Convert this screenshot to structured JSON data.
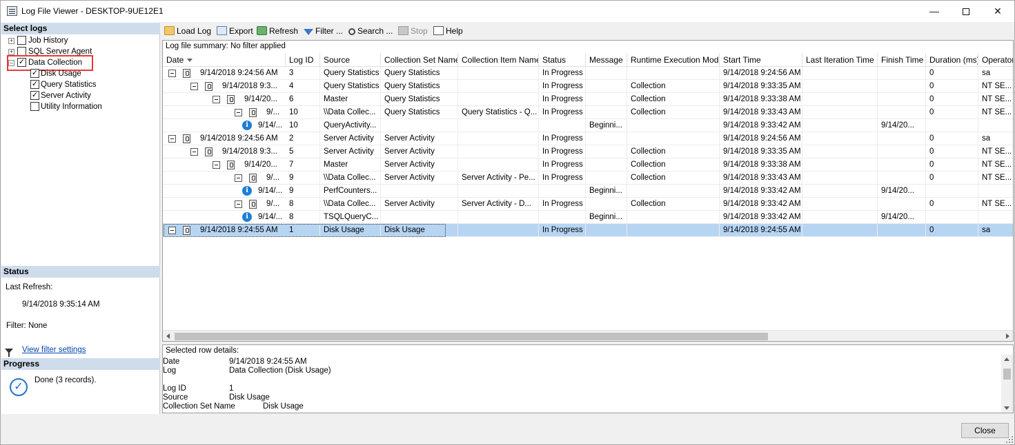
{
  "window": {
    "title": "Log File Viewer - DESKTOP-9UE12E1"
  },
  "left": {
    "select_logs_header": "Select logs",
    "tree": {
      "job_history": "Job History",
      "sql_server_agent": "SQL Server Agent",
      "data_collection": "Data Collection",
      "children": [
        "Disk Usage",
        "Query Statistics",
        "Server Activity",
        "Utility Information"
      ]
    },
    "status": {
      "header": "Status",
      "last_refresh_label": "Last Refresh:",
      "last_refresh_value": "9/14/2018 9:35:14 AM",
      "filter": "Filter: None",
      "view_filter_link": "View filter settings"
    },
    "progress": {
      "header": "Progress",
      "text": "Done (3 records)."
    }
  },
  "toolbar": {
    "load_log": "Load Log",
    "export": "Export",
    "refresh": "Refresh",
    "filter": "Filter ...",
    "search": "Search ...",
    "stop": "Stop",
    "help": "Help"
  },
  "grid": {
    "summary": "Log file summary: No filter applied",
    "columns": [
      "Date",
      "Log ID",
      "Source",
      "Collection Set Name",
      "Collection Item Name",
      "Status",
      "Message",
      "Runtime Execution Mode",
      "Start Time",
      "Last Iteration Time",
      "Finish Time",
      "Duration (ms)",
      "Operator"
    ],
    "rows": [
      {
        "date": "9/14/2018 9:24:56 AM",
        "log_id": "3",
        "source": "Query Statistics",
        "set": "Query Statistics",
        "item": "",
        "status": "In Progress",
        "message": "",
        "mode": "",
        "start": "9/14/2018 9:24:56 AM",
        "last": "",
        "finish": "",
        "duration": "0",
        "operator": "sa"
      },
      {
        "date": "9/14/2018 9:3...",
        "log_id": "4",
        "source": "Query Statistics",
        "set": "Query Statistics",
        "item": "",
        "status": "In Progress",
        "message": "",
        "mode": "Collection",
        "start": "9/14/2018 9:33:35 AM",
        "last": "",
        "finish": "",
        "duration": "0",
        "operator": "NT SE..."
      },
      {
        "date": "9/14/20...",
        "log_id": "6",
        "source": "Master",
        "set": "Query Statistics",
        "item": "",
        "status": "In Progress",
        "message": "",
        "mode": "Collection",
        "start": "9/14/2018 9:33:38 AM",
        "last": "",
        "finish": "",
        "duration": "0",
        "operator": "NT SE..."
      },
      {
        "date": "9/...",
        "log_id": "10",
        "source": "\\\\Data Collec...",
        "set": "Query Statistics",
        "item": "Query Statistics - Q...",
        "status": "In Progress",
        "message": "",
        "mode": "Collection",
        "start": "9/14/2018 9:33:43 AM",
        "last": "",
        "finish": "",
        "duration": "0",
        "operator": "NT SE..."
      },
      {
        "date": "9/14/...",
        "log_id": "10",
        "source": "QueryActivity...",
        "set": "",
        "item": "",
        "status": "",
        "message": "Beginni...",
        "mode": "",
        "start": "9/14/2018 9:33:42 AM",
        "last": "",
        "finish": "9/14/20...",
        "duration": "",
        "operator": ""
      },
      {
        "date": "9/14/2018 9:24:56 AM",
        "log_id": "2",
        "source": "Server Activity",
        "set": "Server Activity",
        "item": "",
        "status": "In Progress",
        "message": "",
        "mode": "",
        "start": "9/14/2018 9:24:56 AM",
        "last": "",
        "finish": "",
        "duration": "0",
        "operator": "sa"
      },
      {
        "date": "9/14/2018 9:3...",
        "log_id": "5",
        "source": "Server Activity",
        "set": "Server Activity",
        "item": "",
        "status": "In Progress",
        "message": "",
        "mode": "Collection",
        "start": "9/14/2018 9:33:35 AM",
        "last": "",
        "finish": "",
        "duration": "0",
        "operator": "NT SE..."
      },
      {
        "date": "9/14/20...",
        "log_id": "7",
        "source": "Master",
        "set": "Server Activity",
        "item": "",
        "status": "In Progress",
        "message": "",
        "mode": "Collection",
        "start": "9/14/2018 9:33:38 AM",
        "last": "",
        "finish": "",
        "duration": "0",
        "operator": "NT SE..."
      },
      {
        "date": "9/...",
        "log_id": "9",
        "source": "\\\\Data Collec...",
        "set": "Server Activity",
        "item": "Server Activity - Pe...",
        "status": "In Progress",
        "message": "",
        "mode": "Collection",
        "start": "9/14/2018 9:33:43 AM",
        "last": "",
        "finish": "",
        "duration": "0",
        "operator": "NT SE..."
      },
      {
        "date": "9/14/...",
        "log_id": "9",
        "source": "PerfCounters...",
        "set": "",
        "item": "",
        "status": "",
        "message": "Beginni...",
        "mode": "",
        "start": "9/14/2018 9:33:42 AM",
        "last": "",
        "finish": "9/14/20...",
        "duration": "",
        "operator": ""
      },
      {
        "date": "9/...",
        "log_id": "8",
        "source": "\\\\Data Collec...",
        "set": "Server Activity",
        "item": "Server Activity - D...",
        "status": "In Progress",
        "message": "",
        "mode": "Collection",
        "start": "9/14/2018 9:33:42 AM",
        "last": "",
        "finish": "",
        "duration": "0",
        "operator": "NT SE..."
      },
      {
        "date": "9/14/...",
        "log_id": "8",
        "source": "TSQLQueryC...",
        "set": "",
        "item": "",
        "status": "",
        "message": "Beginni...",
        "mode": "",
        "start": "9/14/2018 9:33:42 AM",
        "last": "",
        "finish": "9/14/20...",
        "duration": "",
        "operator": ""
      },
      {
        "date": "9/14/2018 9:24:55 AM",
        "log_id": "1",
        "source": "Disk Usage",
        "set": "Disk Usage",
        "item": "",
        "status": "In Progress",
        "message": "",
        "mode": "",
        "start": "9/14/2018 9:24:55 AM",
        "last": "",
        "finish": "",
        "duration": "0",
        "operator": "sa"
      }
    ]
  },
  "details": {
    "header": "Selected row details:",
    "lines": [
      {
        "label": "Date",
        "value": "9/14/2018 9:24:55 AM"
      },
      {
        "label": "Log",
        "value": "Data Collection (Disk Usage)"
      },
      {
        "label": "Log ID",
        "value": "1"
      },
      {
        "label": "Source",
        "value": "Disk Usage"
      },
      {
        "label": "Collection Set Name",
        "value": "Disk Usage"
      }
    ]
  },
  "footer": {
    "close": "Close"
  }
}
